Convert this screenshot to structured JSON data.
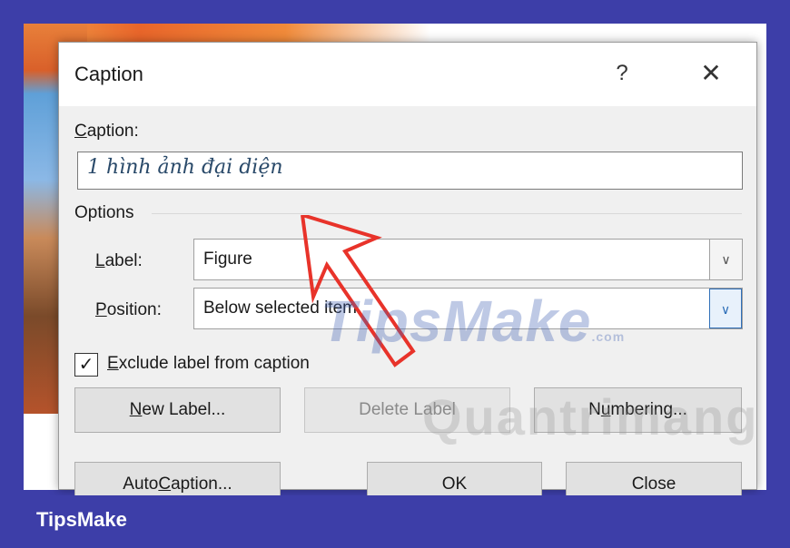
{
  "dialog": {
    "title": "Caption",
    "help_label": "?",
    "close_label": "✕"
  },
  "caption": {
    "label_prefix": "C",
    "label_rest": "aption:",
    "value": "1 hình ảnh đại diện"
  },
  "options": {
    "heading": "Options",
    "label_field": {
      "label_prefix": "L",
      "label_rest": "abel:",
      "value": "Figure"
    },
    "position_field": {
      "label_prefix": "P",
      "label_rest": "osition:",
      "value": "Below selected item"
    },
    "exclude_checkbox": {
      "label_prefix": "E",
      "label_rest": "xclude label from caption",
      "checked": true
    }
  },
  "buttons": {
    "new_label": {
      "prefix": "N",
      "rest": "ew Label..."
    },
    "delete_label": "Delete Label",
    "numbering": {
      "before": "N",
      "underlined": "u",
      "after": "mbering..."
    },
    "autocaption": {
      "before": "Auto",
      "underlined": "C",
      "after": "aption..."
    },
    "ok": "OK",
    "close": "Close"
  },
  "watermarks": {
    "tipsmake": "TipsMake",
    "tipsmake_suffix": ".com",
    "quantrimang": "Quantrimang"
  },
  "brand": "TipsMake",
  "colors": {
    "frame": "#3d3ea8",
    "arrow": "#e8332a",
    "dropdown_focus": "#2f6fb8"
  }
}
